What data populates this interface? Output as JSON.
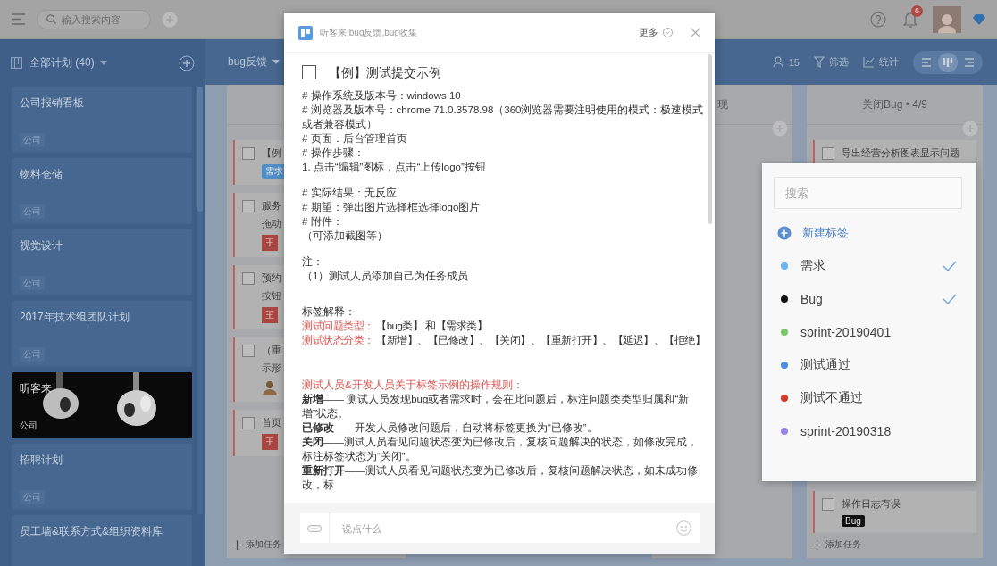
{
  "top_bar": {
    "search": {
      "placeholder": "输入搜索内容"
    },
    "notifications": {
      "badge": "6"
    }
  },
  "sidebar": {
    "title": "全部计划 (40)",
    "plans": [
      {
        "name": "公司报销看板",
        "tag": "公司",
        "kind": "plain"
      },
      {
        "name": "物料仓储",
        "tag": "公司",
        "kind": "plain"
      },
      {
        "name": "视觉设计",
        "tag": "公司",
        "kind": "plain"
      },
      {
        "name": "2017年技术组团队计划",
        "tag": "公司",
        "kind": "plain"
      },
      {
        "name": "听客来",
        "tag": "公司",
        "kind": "picture"
      },
      {
        "name": "招聘计划",
        "tag": "公司",
        "kind": "plain"
      },
      {
        "name": "员工墙&联系方式&组织资料库",
        "kind": "plain"
      }
    ]
  },
  "board": {
    "title": "bug反馈",
    "members": "15",
    "filter": "筛选",
    "stats": "统计",
    "views": [
      {
        "selected": false
      },
      {
        "selected": true
      },
      {
        "selected": false
      }
    ],
    "columns": [
      {
        "cards": [
          {
            "title": "【例",
            "done": false,
            "tags": [
              {
                "text": "需求",
                "color": "#4f8fc8"
              }
            ]
          },
          {
            "title": "服务",
            "done": false,
            "text": "拖动",
            "assignee": {
              "kind": "initial",
              "text": "王"
            }
          },
          {
            "title": "预约",
            "done": false,
            "text": "按钮",
            "assignee": {
              "kind": "initial",
              "text": "王"
            }
          },
          {
            "title": "（重",
            "done": false,
            "text": "示形",
            "assignee": {
              "kind": "avatar"
            }
          },
          {
            "title": "首页",
            "done": false,
            "assignee": {
              "kind": "initial",
              "text": "王"
            }
          }
        ],
        "add_label": "添加任务"
      },
      {
        "title": "现"
      },
      {
        "title": "关闭Bug • 4/9",
        "cards": [
          {
            "title": "导出经营分析图表显示问题",
            "done": false
          },
          {
            "title": "操作日志有误",
            "done": false,
            "tags": [
              {
                "text": "Bug",
                "color": "#111111"
              }
            ]
          }
        ],
        "add_label": "添加任务"
      }
    ]
  },
  "modal": {
    "breadcrumb": "听客来,bug反馈,bug收集",
    "more": "更多",
    "task": {
      "title": "【例】测试提交示例",
      "done": false
    },
    "sections": [
      {
        "lines": [
          {
            "kind": "plain",
            "text": "# 操作系统及版本号：windows 10"
          },
          {
            "kind": "plain",
            "text": "# 浏览器及版本号：chrome 71.0.3578.98（360浏览器需要注明使用的模式：极速模式或者兼容模式）"
          },
          {
            "kind": "plain",
            "text": "# 页面：后台管理首页"
          },
          {
            "kind": "plain",
            "text": "# 操作步骤："
          },
          {
            "kind": "plain",
            "text": "1. 点击“编辑”图标，点击“上传logo”按钮"
          }
        ]
      },
      {
        "lines": [
          {
            "kind": "plain",
            "text": "# 实际结果：无反应"
          },
          {
            "kind": "plain",
            "text": "# 期望：弹出图片选择框选择logo图片"
          },
          {
            "kind": "plain",
            "text": "# 附件："
          },
          {
            "kind": "plain",
            "text": "（可添加截图等）"
          }
        ]
      },
      {
        "lines": [
          {
            "kind": "plain",
            "text": "注："
          },
          {
            "kind": "plain",
            "text": "（1）测试人员添加自己为任务成员"
          }
        ]
      },
      {
        "lines": [
          {
            "kind": "plain",
            "text": "标签解释："
          },
          {
            "kind": "label",
            "label": "测试问题类型：",
            "text": "【bug类】 和【需求类】"
          },
          {
            "kind": "label",
            "label": "测试状态分类：",
            "text": "【新增】、【已修改】、【关闭】、【重新打开】、【延迟】、【拒绝】"
          }
        ]
      },
      {
        "lines": [
          {
            "kind": "heading",
            "text": "测试人员&开发人员关于标签示例的操作规则："
          },
          {
            "kind": "plain",
            "text": "**新增**—— 测试人员发现bug或者需求时，会在此问题后，标注问题类类型归属和“新增”状态。"
          },
          {
            "kind": "plain",
            "text": "**已修改**——开发人员修改问题后，自动将标签更换为“已修改”。"
          },
          {
            "kind": "plain",
            "text": "**关闭**——测试人员看见问题状态变为已修改后，复核问题解决的状态，如修改完成，标注标签状态为“关闭”。"
          },
          {
            "kind": "plain",
            "text": "**重新打开**——测试人员看见问题状态变为已修改后，复核问题解决状态，如未成功修改，标"
          }
        ]
      }
    ],
    "comment": {
      "placeholder": "说点什么"
    }
  },
  "tag_popup": {
    "search": {
      "placeholder": "搜索"
    },
    "create_label": "新建标签",
    "tags": [
      {
        "name": "需求",
        "color": "#6cb4ee",
        "selected": true
      },
      {
        "name": "Bug",
        "color": "#111111",
        "selected": true
      },
      {
        "name": "sprint-20190401",
        "color": "#7cc66a",
        "selected": false
      },
      {
        "name": "测试通过",
        "color": "#4a8fd8",
        "selected": false
      },
      {
        "name": "测试不通过",
        "color": "#c83a2a",
        "selected": false
      },
      {
        "name": "sprint-20190318",
        "color": "#9b87e8",
        "selected": false
      }
    ]
  }
}
